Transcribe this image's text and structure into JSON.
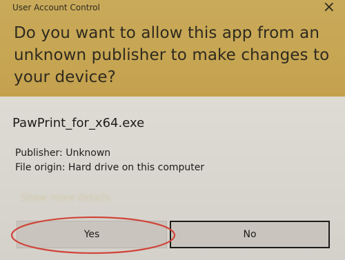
{
  "dialog": {
    "title": "User Account Control",
    "close_glyph": "×",
    "question": "Do you want to allow this app from an unknown publisher to make changes to your device?",
    "app_name": "PawPrint_for_x64.exe",
    "publisher": "Publisher: Unknown",
    "file_origin": "File origin: Hard drive on this computer",
    "details_link": "Show more details",
    "yes_label": "Yes",
    "no_label": "No"
  },
  "colors": {
    "header": "#c7a653",
    "body": "#d9d6cf",
    "button": "#c9c5be",
    "annotation": "#d0453a"
  },
  "icons": {
    "close": "close-icon"
  }
}
